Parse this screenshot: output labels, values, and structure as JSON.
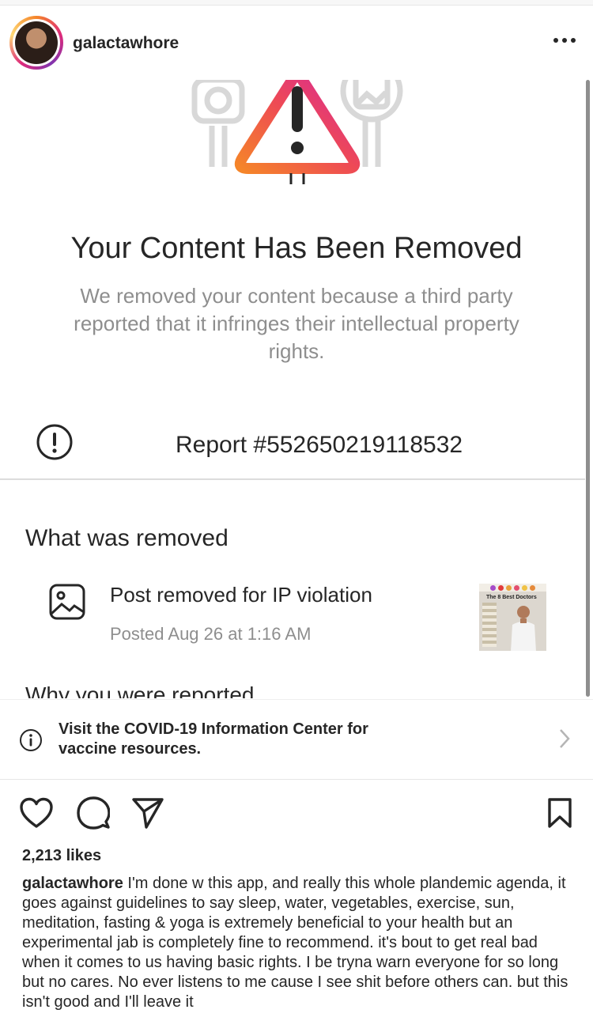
{
  "post_header": {
    "username": "galactawhore"
  },
  "notice": {
    "title": "Your Content Has Been Removed",
    "description": "We removed your content because a third party reported that it infringes their intellectual property rights.",
    "report_label": "Report #552650219118532",
    "section_heading": "What was removed",
    "removed_item": {
      "title": "Post removed for IP violation",
      "posted": "Posted Aug 26 at 1:16 AM",
      "thumbnail_caption": "The 8 Best Doctors"
    },
    "cut_heading": "Why you were reported"
  },
  "covid_banner": {
    "text": "Visit the COVID-19 Information Center for vaccine resources."
  },
  "engagement": {
    "likes": "2,213 likes"
  },
  "caption": {
    "author": "galactawhore",
    "text": "I'm done w this app, and really this whole plandemic agenda, it goes against guidelines to say sleep, water, vegetables, exercise, sun, meditation, fasting & yoga is extremely beneficial to your health but an experimental jab is completely fine to recommend. it's bout to get real bad when it comes to us having basic rights. I be tryna warn everyone for so long but no cares. No ever listens to me cause I see shit before others can. but this isn't good and I'll leave it"
  },
  "icons": {
    "more": "more-options-icon",
    "warning": "warning-triangle-icon",
    "report": "exclamation-circle-icon",
    "image": "image-icon",
    "info": "info-circle-icon",
    "chevron": "chevron-right-icon",
    "like": "heart-icon",
    "comment": "comment-icon",
    "share": "send-icon",
    "save": "bookmark-icon"
  },
  "colors": {
    "gradient_start": "#f58529",
    "gradient_mid": "#dd2a7b",
    "gradient_end": "#8134af",
    "muted_text": "#8e8e8e"
  }
}
